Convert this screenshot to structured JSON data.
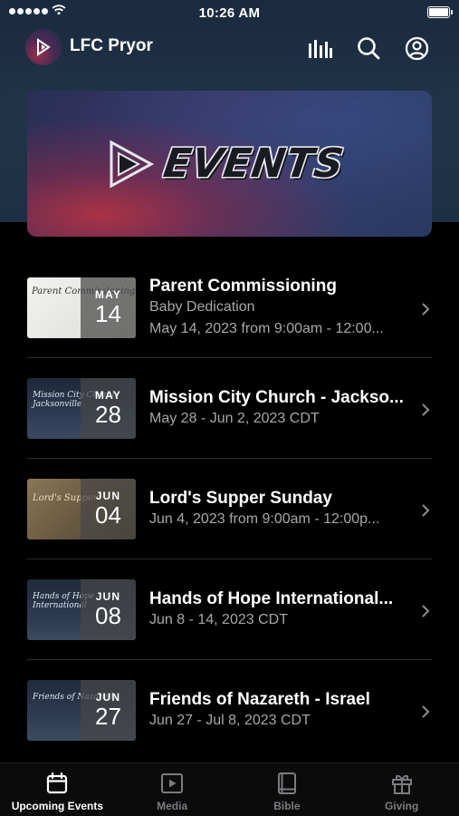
{
  "status_bar": {
    "time": "10:26 AM"
  },
  "header": {
    "title": "LFC Pryor",
    "icons": [
      "bars-icon",
      "search-icon",
      "profile-icon"
    ]
  },
  "banner": {
    "text": "EVENTS"
  },
  "events": [
    {
      "title": "Parent Commissioning",
      "subtitle": "Baby Dedication",
      "detail": "May 14, 2023 from 9:00am - 12:00...",
      "month": "MAY",
      "day": "14",
      "thumb_text": "Parent Commissioning"
    },
    {
      "title": "Mission City Church - Jackso...",
      "detail": "May 28 - Jun 2, 2023 CDT",
      "month": "MAY",
      "day": "28",
      "thumb_text": "Mission City Church Jacksonville"
    },
    {
      "title": "Lord's Supper Sunday",
      "detail": "Jun 4, 2023 from 9:00am - 12:00p...",
      "month": "JUN",
      "day": "04",
      "thumb_text": "Lord's Supper"
    },
    {
      "title": "Hands of Hope International...",
      "detail": "Jun 8 - 14, 2023 CDT",
      "month": "JUN",
      "day": "08",
      "thumb_text": "Hands of Hope International"
    },
    {
      "title": "Friends of Nazareth - Israel",
      "detail": "Jun 27 - Jul 8, 2023 CDT",
      "month": "JUN",
      "day": "27",
      "thumb_text": "Friends of Nazareth"
    }
  ],
  "tabs": [
    {
      "label": "Upcoming Events",
      "icon": "calendar-icon",
      "active": true
    },
    {
      "label": "Media",
      "icon": "play-icon",
      "active": false
    },
    {
      "label": "Bible",
      "icon": "book-icon",
      "active": false
    },
    {
      "label": "Giving",
      "icon": "gift-icon",
      "active": false
    }
  ]
}
